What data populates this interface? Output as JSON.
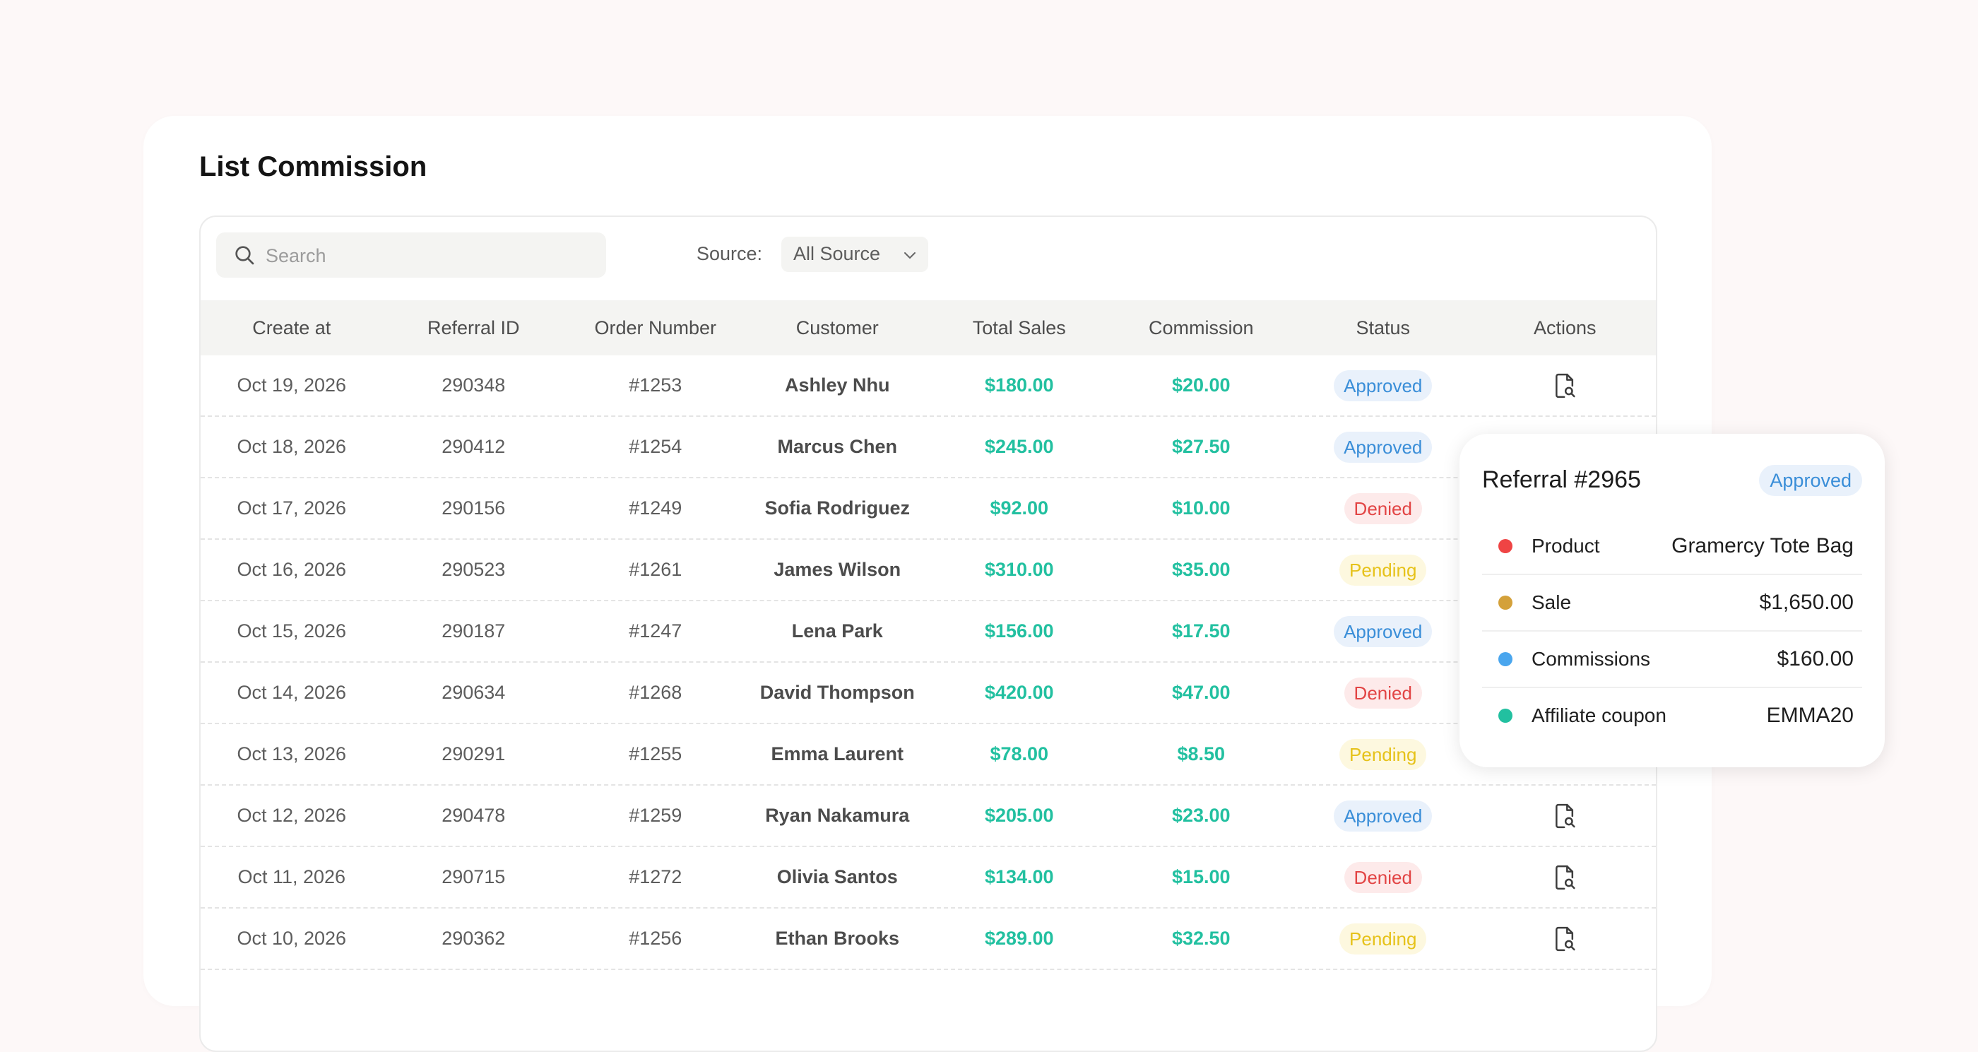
{
  "page": {
    "title": "List Commission"
  },
  "toolbar": {
    "search_placeholder": "Search",
    "source_label": "Source:",
    "source_value": "All Source"
  },
  "table": {
    "columns": [
      "Create at",
      "Referral ID",
      "Order Number",
      "Customer",
      "Total Sales",
      "Commission",
      "Status",
      "Actions"
    ],
    "rows": [
      {
        "date": "Oct 19, 2026",
        "ref": "290348",
        "order": "#1253",
        "customer": "Ashley Nhu",
        "sales": "$180.00",
        "commission": "$20.00",
        "status": "Approved"
      },
      {
        "date": "Oct 18, 2026",
        "ref": "290412",
        "order": "#1254",
        "customer": "Marcus Chen",
        "sales": "$245.00",
        "commission": "$27.50",
        "status": "Approved"
      },
      {
        "date": "Oct 17, 2026",
        "ref": "290156",
        "order": "#1249",
        "customer": "Sofia Rodriguez",
        "sales": "$92.00",
        "commission": "$10.00",
        "status": "Denied"
      },
      {
        "date": "Oct 16, 2026",
        "ref": "290523",
        "order": "#1261",
        "customer": "James Wilson",
        "sales": "$310.00",
        "commission": "$35.00",
        "status": "Pending"
      },
      {
        "date": "Oct 15, 2026",
        "ref": "290187",
        "order": "#1247",
        "customer": "Lena Park",
        "sales": "$156.00",
        "commission": "$17.50",
        "status": "Approved"
      },
      {
        "date": "Oct 14, 2026",
        "ref": "290634",
        "order": "#1268",
        "customer": "David Thompson",
        "sales": "$420.00",
        "commission": "$47.00",
        "status": "Denied"
      },
      {
        "date": "Oct 13, 2026",
        "ref": "290291",
        "order": "#1255",
        "customer": "Emma Laurent",
        "sales": "$78.00",
        "commission": "$8.50",
        "status": "Pending"
      },
      {
        "date": "Oct 12, 2026",
        "ref": "290478",
        "order": "#1259",
        "customer": "Ryan Nakamura",
        "sales": "$205.00",
        "commission": "$23.00",
        "status": "Approved"
      },
      {
        "date": "Oct 11, 2026",
        "ref": "290715",
        "order": "#1272",
        "customer": "Olivia Santos",
        "sales": "$134.00",
        "commission": "$15.00",
        "status": "Denied"
      },
      {
        "date": "Oct 10, 2026",
        "ref": "290362",
        "order": "#1256",
        "customer": "Ethan Brooks",
        "sales": "$289.00",
        "commission": "$32.50",
        "status": "Pending"
      }
    ],
    "action_icon": "document-search-icon"
  },
  "popup": {
    "title": "Referral #2965",
    "status": "Approved",
    "items": [
      {
        "label": "Product",
        "value": "Gramercy Tote Bag",
        "color": "#ef4444"
      },
      {
        "label": "Sale",
        "value": "$1,650.00",
        "color": "#d4a13a"
      },
      {
        "label": "Commissions",
        "value": "$160.00",
        "color": "#4aa6ee"
      },
      {
        "label": "Affiliate coupon",
        "value": "EMMA20",
        "color": "#22c0a0"
      }
    ]
  },
  "colors": {
    "accent_green": "#22c0a0",
    "approved": "#3a8ed8",
    "denied": "#e24444",
    "pending": "#e6c21a"
  }
}
